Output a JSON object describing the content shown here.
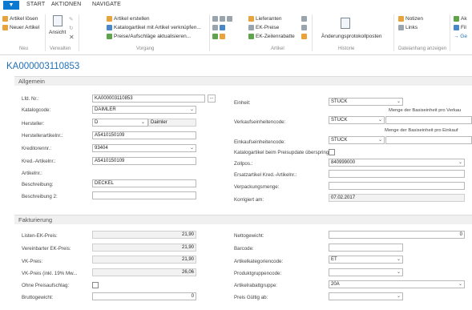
{
  "tabs": {
    "app_arrow": "▼",
    "start": "START",
    "aktionen": "AKTIONEN",
    "navigate": "NAVIGATE"
  },
  "ribbon": {
    "artikel_loesen": "Artikel lösen",
    "neuer_artikel": "Neuer Artikel",
    "ansicht": "Ansicht",
    "artikel_erstellen": "Artikel erstellen",
    "katalogartikel_verknuepfen": "Katalogartikel mit Artikel verknüpfen...",
    "preise_aktualisieren": "Preise/Aufschläge aktualisieren...",
    "lieferanten": "Lieferanten",
    "ek_preise": "EK-Preise",
    "ek_zeilenrabatte": "EK-Zeilenrabatte",
    "aenderungsprotokollposten": "Änderungsprotokollposten",
    "notizen": "Notizen",
    "links": "Links",
    "akt": "Ak",
    "fil": "Fil",
    "ge": "→ Ge",
    "group_neu": "Neu",
    "group_verwalten": "Verwalten",
    "group_vorgang": "Vorgang",
    "group_artikel": "Artikel",
    "group_historie": "Historie",
    "group_dateianhang": "Dateianhang anzeigen"
  },
  "page_title": "KA000003110853",
  "allgemein": {
    "header": "Allgemein",
    "lfd_nr_label": "Lfd. Nr.:",
    "lfd_nr": "KA000003110853",
    "assist": "...",
    "katalogcode_label": "Katalogcode:",
    "katalogcode": "DAIMLER",
    "hersteller_label": "Hersteller:",
    "hersteller": "D",
    "hersteller_name": "Daimler",
    "herstellerartikelnr_label": "Herstellerartikelnr.:",
    "herstellerartikelnr": "A5410150109",
    "kreditorennr_label": "Kreditorennr.:",
    "kreditorennr": "93404",
    "kred_artikelnr_label": "Kred.-Artikelnr.:",
    "kred_artikelnr": "A5410150109",
    "artikelnr_label": "Artikelnr.:",
    "beschreibung_label": "Beschreibung:",
    "beschreibung": "DECKEL",
    "beschreibung2_label": "Beschreibung 2:",
    "einheit_label": "Einheit:",
    "einheit": "STÜCK",
    "menge_vk_note": "Menge der Basiseinheit pro Verkau",
    "vk_einheit_label": "Verkaufseinheitencode:",
    "vk_einheit": "STÜCK",
    "menge_ek_note": "Menge der Basiseinheit pro Einkauf",
    "ek_einheit_label": "Einkaufseinheitencode:",
    "ek_einheit": "STÜCK",
    "katalog_preisupdate_label": "Katalogartikel beim Preisupdate überspring...",
    "zollpos_label": "Zollpos.:",
    "zollpos": "840999000",
    "ersatzartikel_label": "Ersatzartikel Kred.-Artikelnr.:",
    "verpackungsmenge_label": "Verpackungsmenge:",
    "korrigiert_label": "Korrigiert am:",
    "korrigiert": "07.02.2017"
  },
  "fakturierung": {
    "header": "Fakturierung",
    "listen_ek_label": "Listen-EK-Preis:",
    "listen_ek": "21,90",
    "vereinbarter_ek_label": "Vereinbarter EK-Preis:",
    "vereinbarter_ek": "21,90",
    "vk_preis_label": "VK-Preis:",
    "vk_preis": "21,90",
    "vk_preis_mwst_label": "VK-Preis (inkl. 19% Mw...",
    "vk_preis_mwst": "26,06",
    "ohne_preisaufschlag_label": "Ohne Preisaufschlag:",
    "bruttogewicht_label": "Bruttogewicht:",
    "bruttogewicht": "0",
    "nettogewicht_label": "Nettogewicht:",
    "nettogewicht": "0",
    "barcode_label": "Barcode:",
    "artikelkategorie_label": "Artikelkategoriencode:",
    "artikelkategorie": "ET",
    "produktgruppe_label": "Produktgruppencode:",
    "artikelrabattgruppe_label": "Artikelrabattgruppe:",
    "artikelrabattgruppe": "20A",
    "preis_gueltig_label": "Preis Gültig ab:"
  },
  "colors": {
    "accent": "#1f6fb8",
    "app_button": "#0b79d0"
  }
}
